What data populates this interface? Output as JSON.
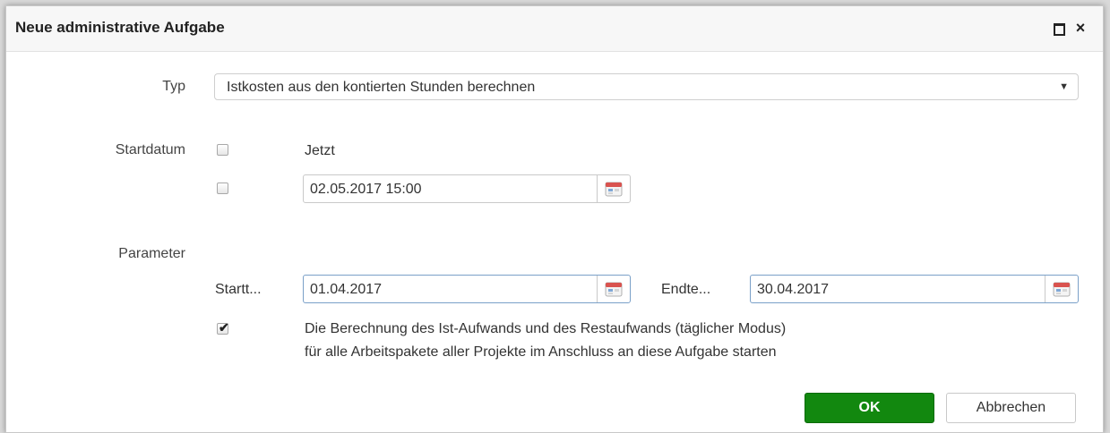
{
  "dialog": {
    "title": "Neue administrative Aufgabe",
    "maximize_icon": "maximize-icon",
    "close_icon": "close-icon",
    "close_glyph": "×"
  },
  "typ": {
    "label": "Typ",
    "selected": "Istkosten aus den kontierten Stunden berechnen",
    "arrow_glyph": "▼"
  },
  "startdatum": {
    "label": "Startdatum",
    "now_checked": false,
    "now_label": "Jetzt",
    "date_checked": false,
    "date_value": "02.05.2017 15:00"
  },
  "parameter": {
    "label": "Parameter",
    "start_label": "Startt...",
    "start_value": "01.04.2017",
    "end_label": "Endte...",
    "end_value": "30.04.2017",
    "calc_checked": true,
    "checkmark_glyph": "✔",
    "calc_line1": "Die Berechnung des Ist-Aufwands und des Restaufwands (täglicher Modus)",
    "calc_line2": "für alle Arbeitspakete aller Projekte im Anschluss an diese Aufgabe starten"
  },
  "buttons": {
    "ok": "OK",
    "cancel": "Abbrechen"
  },
  "colors": {
    "ok_green": "#12880f",
    "focus_border": "#7aa0c8",
    "calendar_red": "#d9534f"
  }
}
